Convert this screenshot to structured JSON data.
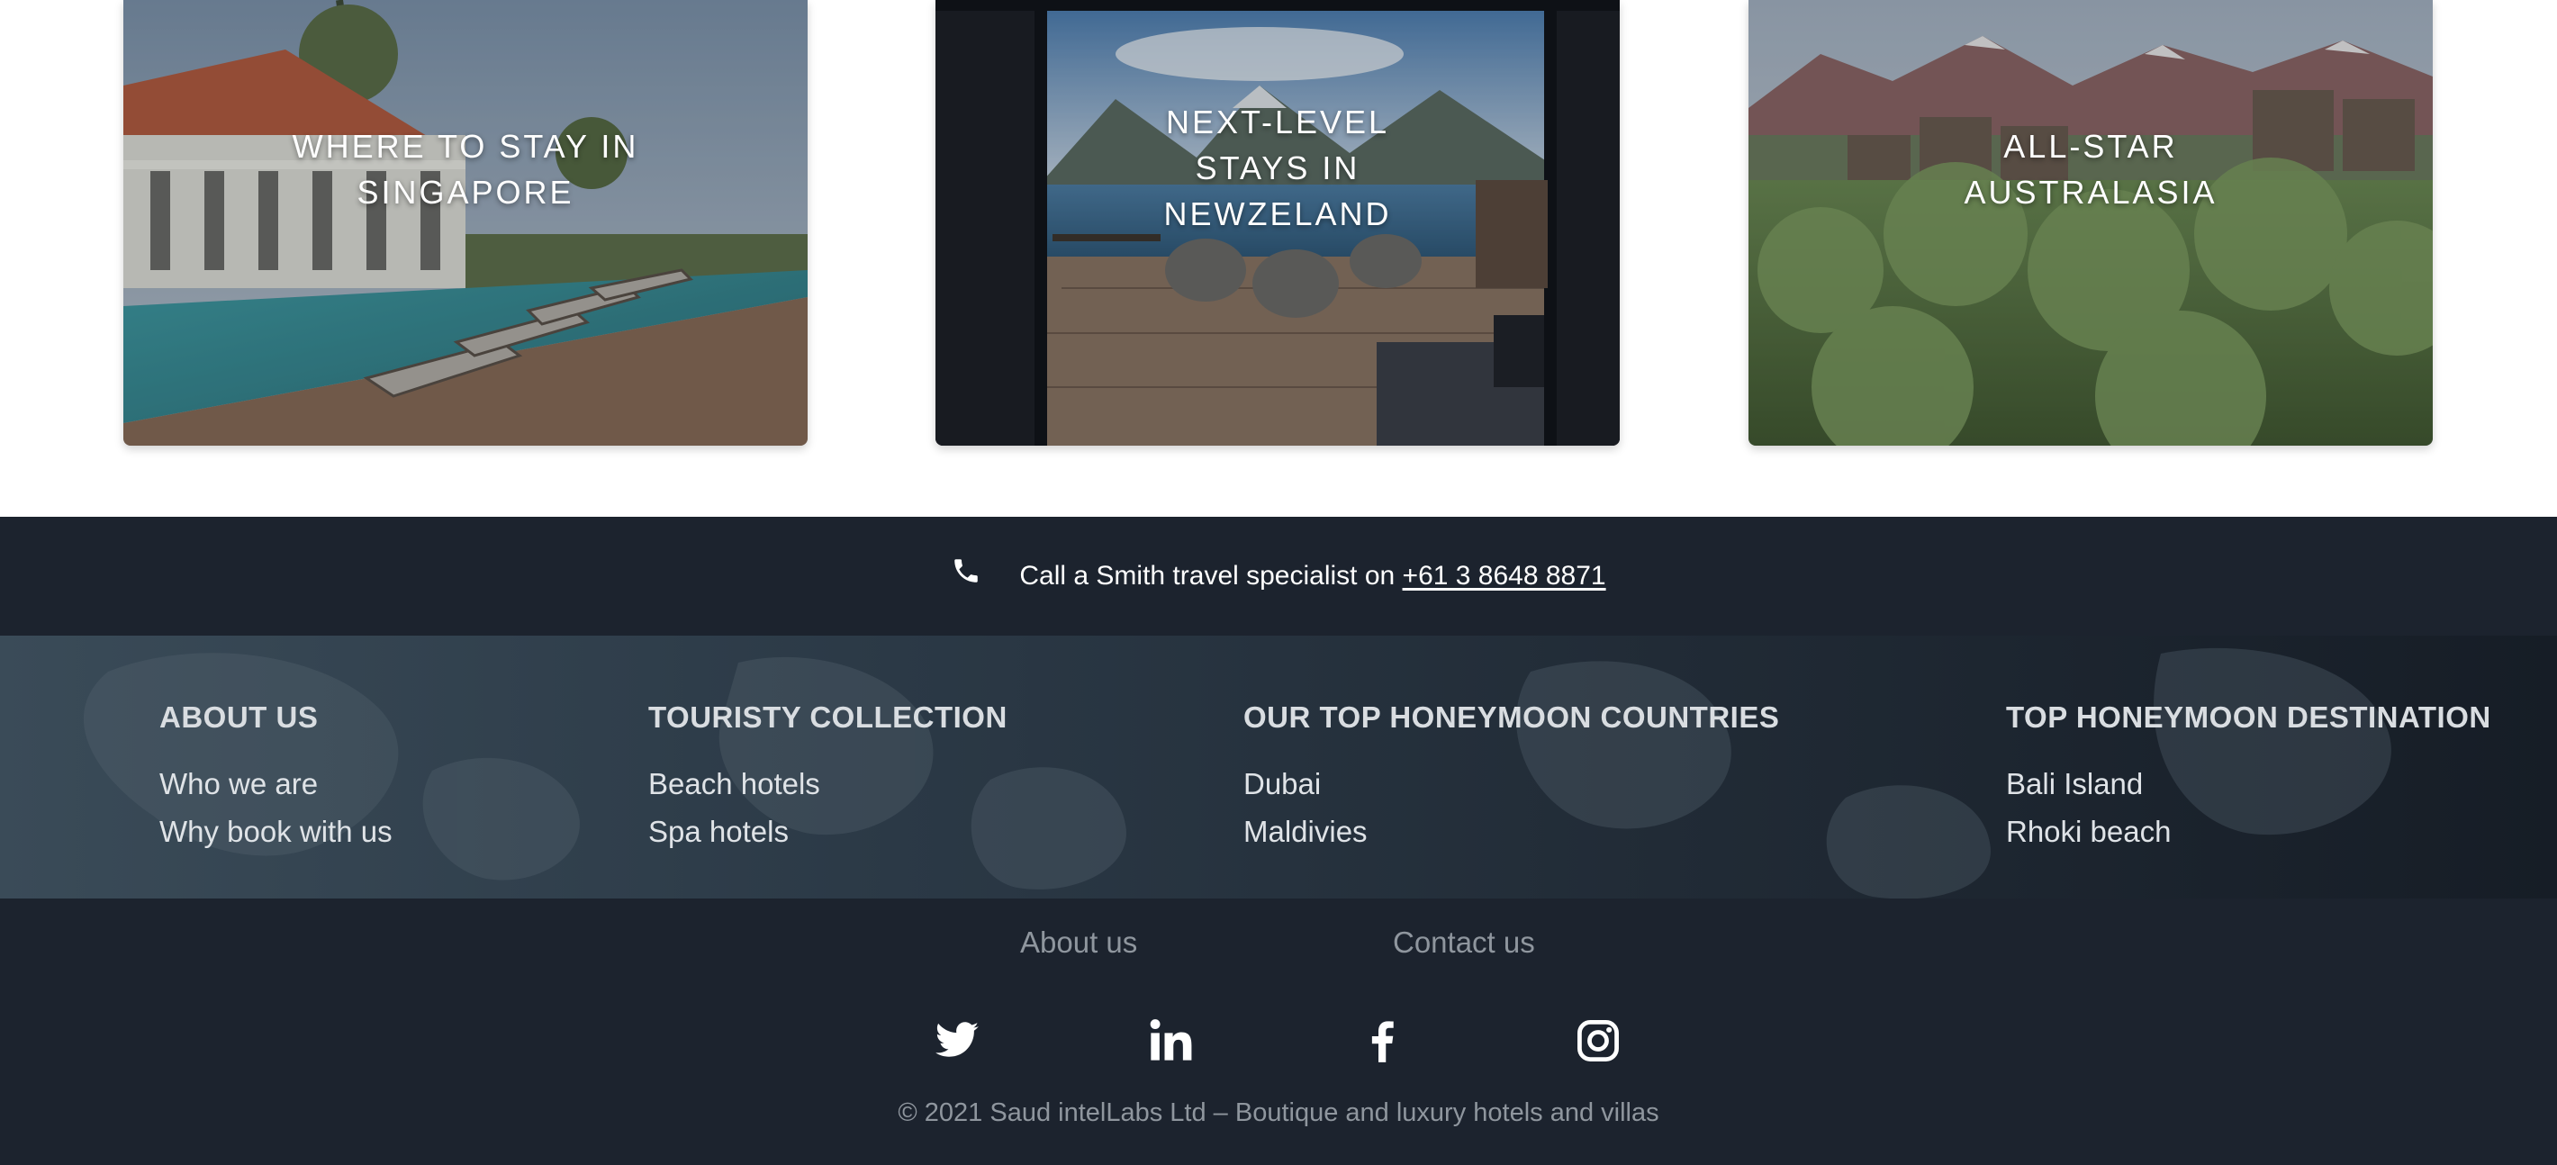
{
  "cards": [
    {
      "title_line1": "WHERE TO STAY IN",
      "title_line2": "SINGAPORE",
      "title_line3": ""
    },
    {
      "title_line1": "NEXT-LEVEL",
      "title_line2": "STAYS IN",
      "title_line3": "NEWZELAND"
    },
    {
      "title_line1": "ALL-STAR",
      "title_line2": "AUSTRALASIA",
      "title_line3": ""
    }
  ],
  "phone_bar": {
    "icon": "phone-icon",
    "lead_text": "Call a Smith travel specialist on ",
    "phone_number": "+61 3 8648 8871"
  },
  "footer_columns": [
    {
      "heading": "ABOUT US",
      "links": [
        "Who we are",
        "Why book with us"
      ]
    },
    {
      "heading": "TOURISTY COLLECTION",
      "links": [
        "Beach hotels",
        "Spa hotels"
      ]
    },
    {
      "heading": "OUR TOP HONEYMOON COUNTRIES",
      "links": [
        "Dubai",
        "Maldivies"
      ]
    },
    {
      "heading": "TOP HONEYMOON DESTINATION",
      "links": [
        "Bali Island",
        "Rhoki beach"
      ]
    }
  ],
  "bottom_nav": {
    "about": "About us",
    "contact": "Contact us"
  },
  "social": [
    "twitter-icon",
    "linkedin-icon",
    "facebook-icon",
    "instagram-icon"
  ],
  "copyright": "© 2021 Saud intelLabs Ltd – Boutique and luxury hotels and villas",
  "colors": {
    "footer_dark": "#1c232e",
    "footer_text_muted": "#8f969e",
    "white": "#ffffff"
  }
}
